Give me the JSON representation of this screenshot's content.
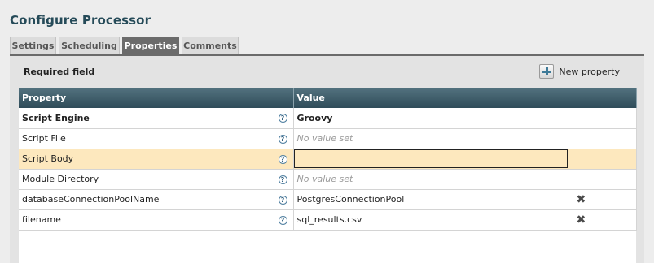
{
  "dialog": {
    "title": "Configure Processor"
  },
  "tabs": [
    {
      "label": "Settings",
      "active": false
    },
    {
      "label": "Scheduling",
      "active": false
    },
    {
      "label": "Properties",
      "active": true
    },
    {
      "label": "Comments",
      "active": false
    }
  ],
  "properties_panel": {
    "required_label": "Required field",
    "new_property_label": "New property",
    "new_property_icon": "plus-icon",
    "table": {
      "headers": [
        "Property",
        "Value",
        ""
      ],
      "rows": [
        {
          "property": "Script Engine",
          "required": true,
          "help_icon": "?",
          "value": "Groovy",
          "value_state": "set",
          "deletable": false,
          "selected": false
        },
        {
          "property": "Script File",
          "required": false,
          "help_icon": "?",
          "value": "No value set",
          "value_state": "empty",
          "deletable": false,
          "selected": false
        },
        {
          "property": "Script Body",
          "required": false,
          "help_icon": "?",
          "value": "",
          "value_state": "editing",
          "deletable": false,
          "selected": true
        },
        {
          "property": "Module Directory",
          "required": false,
          "help_icon": "?",
          "value": "No value set",
          "value_state": "empty",
          "deletable": false,
          "selected": false
        },
        {
          "property": "databaseConnectionPoolName",
          "required": false,
          "help_icon": "?",
          "value": "PostgresConnectionPool",
          "value_state": "set",
          "deletable": true,
          "selected": false
        },
        {
          "property": "filename",
          "required": false,
          "help_icon": "?",
          "value": "sql_results.csv",
          "value_state": "set",
          "deletable": true,
          "selected": false
        }
      ],
      "delete_icon": "✖"
    }
  },
  "colors": {
    "title": "#264b59",
    "header_gradient_top": "#53727f",
    "header_gradient_bottom": "#2f4c59",
    "selected_row": "#fde8be",
    "active_tab": "#6b6b6b"
  }
}
